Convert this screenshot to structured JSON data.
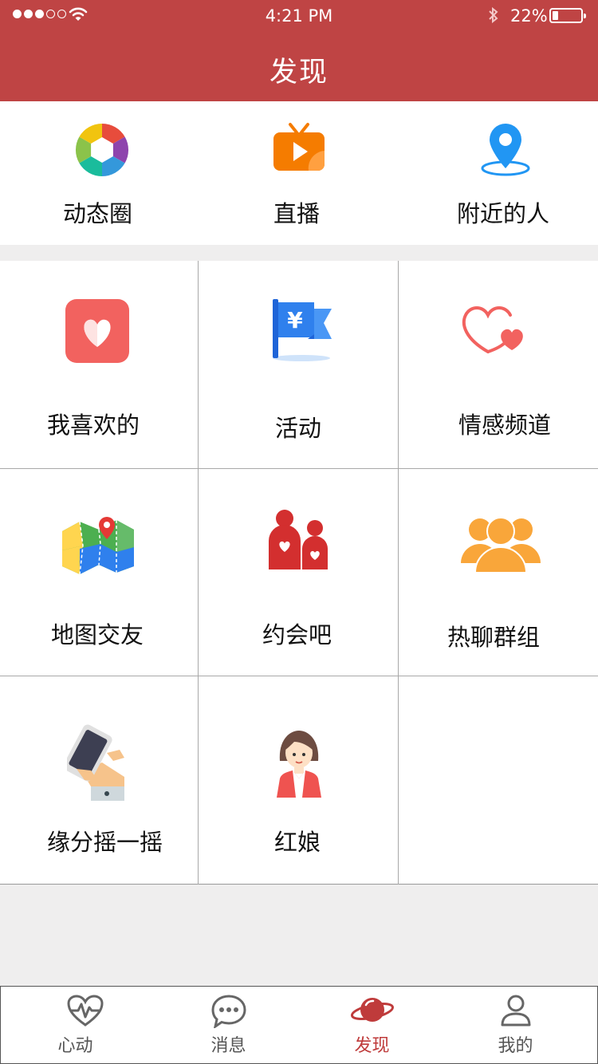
{
  "status_bar": {
    "time": "4:21 PM",
    "battery": "22%"
  },
  "header": {
    "title": "发现"
  },
  "top_items": [
    {
      "label": "动态圈",
      "icon": "aperture-icon"
    },
    {
      "label": "直播",
      "icon": "tv-live-icon"
    },
    {
      "label": "附近的人",
      "icon": "location-pin-icon"
    }
  ],
  "grid_items": [
    {
      "label": "我喜欢的",
      "icon": "heart-card-icon"
    },
    {
      "label": "活动",
      "icon": "yen-flag-icon"
    },
    {
      "label": "情感频道",
      "icon": "double-heart-icon"
    },
    {
      "label": "地图交友",
      "icon": "map-icon"
    },
    {
      "label": "约会吧",
      "icon": "couple-icon"
    },
    {
      "label": "热聊群组",
      "icon": "group-icon"
    },
    {
      "label": "缘分摇一摇",
      "icon": "shake-phone-icon"
    },
    {
      "label": "红娘",
      "icon": "matchmaker-icon"
    }
  ],
  "tabs": [
    {
      "label": "心动",
      "icon": "heartbeat-icon",
      "active": false
    },
    {
      "label": "消息",
      "icon": "chat-bubble-icon",
      "active": false
    },
    {
      "label": "发现",
      "icon": "planet-icon",
      "active": true
    },
    {
      "label": "我的",
      "icon": "user-icon",
      "active": false
    }
  ],
  "colors": {
    "brand": "#bf4444",
    "active_tab": "#bf3b3b",
    "background": "#efeeee"
  }
}
